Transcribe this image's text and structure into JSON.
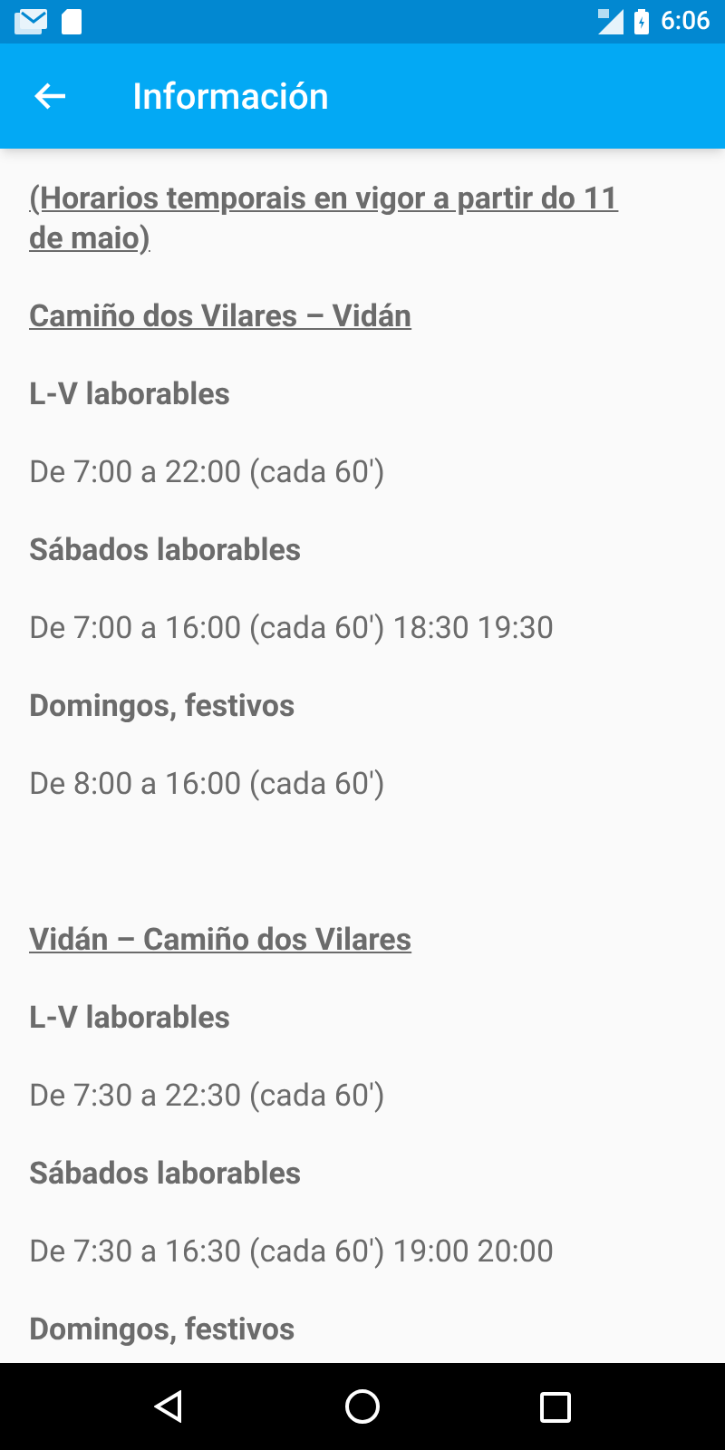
{
  "status_bar": {
    "time": "6:06"
  },
  "app_bar": {
    "title": "Información"
  },
  "notice": "(Horarios temporais en vigor a partir do 11 de maio)",
  "sections": [
    {
      "title": "Camiño dos Vilares – Vidán",
      "schedules": [
        {
          "day": "L-V laborables",
          "hours": "De 7:00 a 22:00 (cada 60')"
        },
        {
          "day": "Sábados laborables",
          "hours": "De 7:00 a 16:00 (cada 60') 18:30 19:30"
        },
        {
          "day": "Domingos, festivos",
          "hours": "De 8:00 a 16:00 (cada 60')"
        }
      ]
    },
    {
      "title": "Vidán – Camiño dos Vilares",
      "schedules": [
        {
          "day": "L-V laborables",
          "hours": "De 7:30 a 22:30 (cada 60')"
        },
        {
          "day": "Sábados laborables",
          "hours": "De 7:30 a 16:30 (cada 60') 19:00 20:00"
        },
        {
          "day": "Domingos, festivos"
        }
      ]
    }
  ]
}
